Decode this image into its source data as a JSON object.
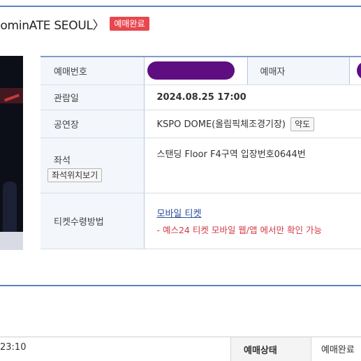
{
  "header": {
    "title": "lominATE SEOUL〉",
    "status_badge": "예매완료"
  },
  "booking": {
    "rows": {
      "booking_number_label": "예매번호",
      "booker_label": "예매자",
      "view_date_label": "관람일",
      "view_date_value": "2024.08.25 17:00",
      "venue_label": "공연장",
      "venue_value": "KSPO DOME(올림픽체조경기장)",
      "map_button": "약도",
      "seat_label": "좌석",
      "seat_map_button": "좌석위치보기",
      "seat_value": "스탠딩 Floor F4구역 입장번호0644번",
      "ticket_method_label": "티켓수령방법",
      "ticket_method_link": "모바일 티켓",
      "ticket_method_notice": "- 예스24 티켓 모바일 웹/앱 에서만 확인 가능"
    }
  },
  "footer": {
    "time": "23:10",
    "status_label": "예매상태",
    "status_value": "예매완료"
  },
  "colors": {
    "accent_border": "#5a84c2",
    "badge": "#e8474f",
    "redaction": "#5e0e80",
    "notice": "#d23a46"
  }
}
